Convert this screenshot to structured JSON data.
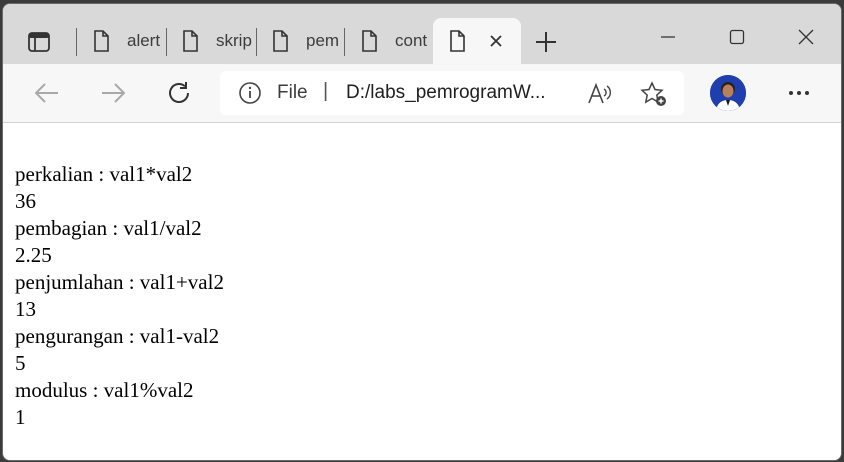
{
  "browser": {
    "tabs": [
      {
        "label": "alert"
      },
      {
        "label": "skrip"
      },
      {
        "label": "pem"
      },
      {
        "label": "cont"
      },
      {
        "label": ""
      }
    ],
    "address": {
      "scheme_label": "File",
      "separator": "|",
      "url": "D:/labs_pemrogramW..."
    }
  },
  "page": {
    "lines": [
      "perkalian : val1*val2",
      "36",
      "pembagian : val1/val2",
      "2.25",
      "penjumlahan : val1+val2",
      "13",
      "pengurangan : val1-val2",
      "5",
      "modulus : val1%val2",
      "1"
    ]
  },
  "colors": {
    "tabstrip": "#d9d9d9",
    "toolbar": "#f7f7f7",
    "avatar_bg": "#1f3fae"
  }
}
